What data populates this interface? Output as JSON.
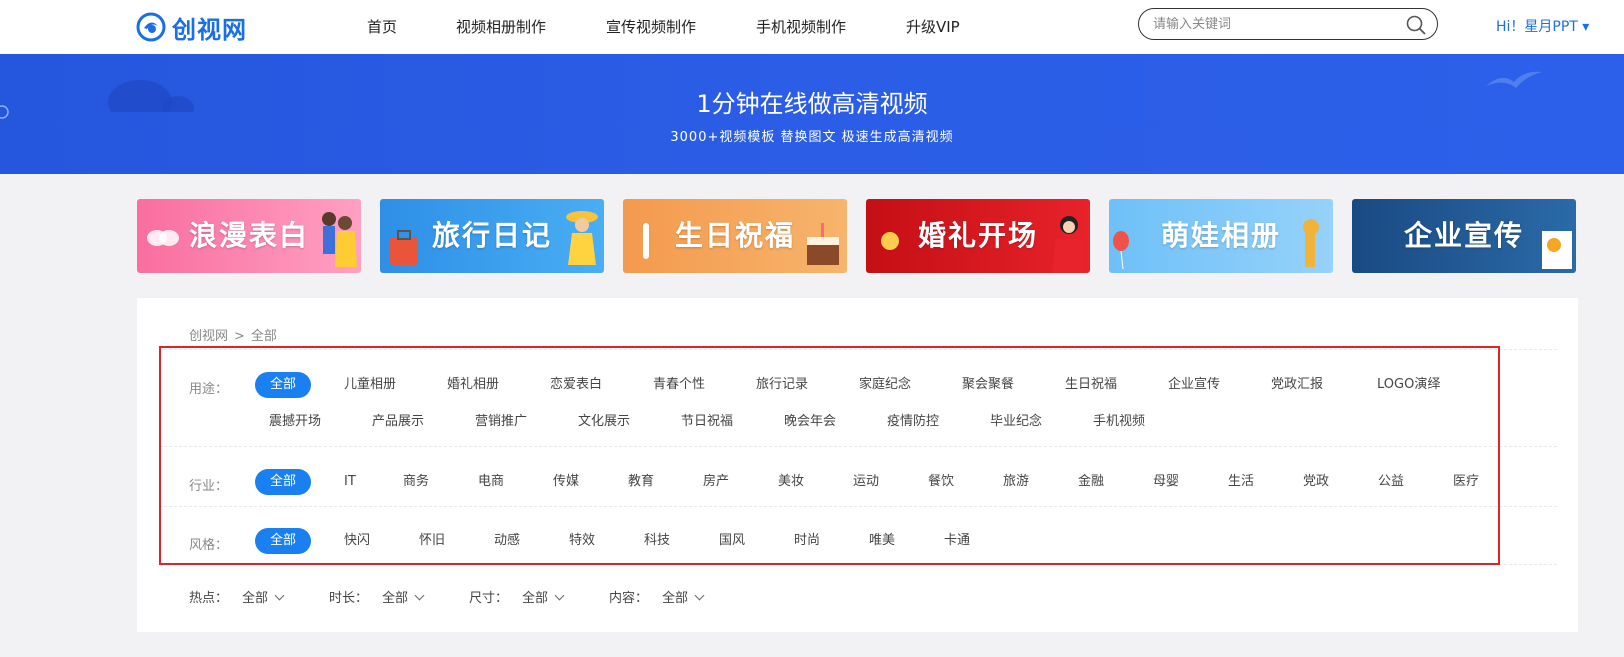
{
  "header": {
    "logo_text": "创视网",
    "nav": [
      {
        "label": "首页"
      },
      {
        "label": "视频相册制作"
      },
      {
        "label": "宣传视频制作"
      },
      {
        "label": "手机视频制作"
      },
      {
        "label": "升级VIP"
      }
    ],
    "search_placeholder": "请输入关键词",
    "user_label": "Hi！星月PPT ▾"
  },
  "banner": {
    "title": "1分钟在线做高清视频",
    "subtitle": "3000+视频模板 替换图文 极速生成高清视频"
  },
  "categories": [
    {
      "label": "浪漫表白",
      "color": "#f77fa6"
    },
    {
      "label": "旅行日记",
      "color": "#3a9be8"
    },
    {
      "label": "生日祝福",
      "color": "#f5a35a"
    },
    {
      "label": "婚礼开场",
      "color": "#d9161c"
    },
    {
      "label": "萌娃相册",
      "color": "#7fc6f7"
    },
    {
      "label": "企业宣传",
      "color": "#1f4f86"
    }
  ],
  "breadcrumb": {
    "home": "创视网",
    "sep": ">",
    "current": "全部"
  },
  "filters": {
    "usage": {
      "label": "用途：",
      "options": [
        "全部",
        "儿童相册",
        "婚礼相册",
        "恋爱表白",
        "青春个性",
        "旅行记录",
        "家庭纪念",
        "聚会聚餐",
        "生日祝福",
        "企业宣传",
        "党政汇报",
        "LOGO演绎",
        "震撼开场",
        "产品展示",
        "营销推广",
        "文化展示",
        "节日祝福",
        "晚会年会",
        "疫情防控",
        "毕业纪念",
        "手机视频"
      ]
    },
    "industry": {
      "label": "行业：",
      "options": [
        "全部",
        "IT",
        "商务",
        "电商",
        "传媒",
        "教育",
        "房产",
        "美妆",
        "运动",
        "餐饮",
        "旅游",
        "金融",
        "母婴",
        "生活",
        "党政",
        "公益",
        "医疗"
      ]
    },
    "style": {
      "label": "风格：",
      "options": [
        "全部",
        "快闪",
        "怀旧",
        "动感",
        "特效",
        "科技",
        "国风",
        "时尚",
        "唯美",
        "卡通"
      ]
    }
  },
  "bottom_filters": [
    {
      "label": "热点：",
      "value": "全部"
    },
    {
      "label": "时长：",
      "value": "全部"
    },
    {
      "label": "尺寸：",
      "value": "全部"
    },
    {
      "label": "内容：",
      "value": "全部"
    }
  ],
  "colors": {
    "brand": "#1a6fe6",
    "active_pill": "#1a7ff0",
    "highlight_box": "#e0232a"
  }
}
